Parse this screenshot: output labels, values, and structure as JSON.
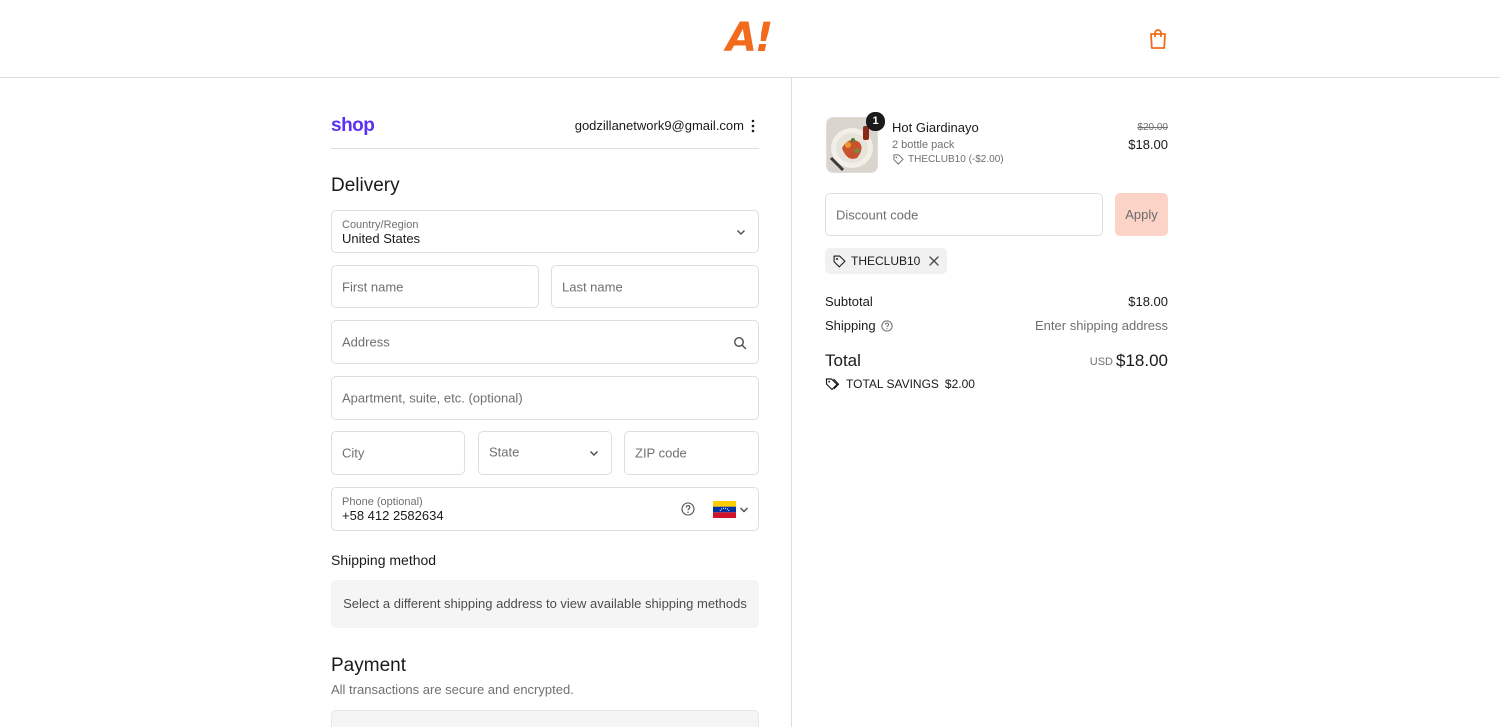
{
  "brand": {
    "logo_text": "A!",
    "accent": "#f26b1d"
  },
  "shop": {
    "logo_text": "shop",
    "color": "#5a31f4"
  },
  "account": {
    "email": "godzillanetwork9@gmail.com"
  },
  "delivery": {
    "heading": "Delivery",
    "country": {
      "label": "Country/Region",
      "value": "United States"
    },
    "first_name": {
      "placeholder": "First name"
    },
    "last_name": {
      "placeholder": "Last name"
    },
    "address": {
      "placeholder": "Address"
    },
    "apartment": {
      "placeholder": "Apartment, suite, etc. (optional)"
    },
    "city": {
      "placeholder": "City"
    },
    "state": {
      "placeholder": "State"
    },
    "zip": {
      "placeholder": "ZIP code"
    },
    "phone": {
      "label": "Phone (optional)",
      "value": "+58 412 2582634"
    }
  },
  "shipping_method": {
    "heading": "Shipping method",
    "message": "Select a different shipping address to view available shipping methods"
  },
  "payment": {
    "heading": "Payment",
    "subtitle": "All transactions are secure and encrypted."
  },
  "order": {
    "item": {
      "quantity": "1",
      "name": "Hot Giardinayo",
      "variant": "2 bottle pack",
      "discount_label": "THECLUB10 (-$2.00)",
      "original_price": "$20.00",
      "price": "$18.00"
    },
    "discount_input": {
      "placeholder": "Discount code"
    },
    "apply_label": "Apply",
    "applied_code": "THECLUB10",
    "subtotal_label": "Subtotal",
    "subtotal_value": "$18.00",
    "shipping_label": "Shipping",
    "shipping_value": "Enter shipping address",
    "total_label": "Total",
    "total_currency": "USD",
    "total_value": "$18.00",
    "savings_label": "TOTAL SAVINGS",
    "savings_value": "$2.00"
  }
}
